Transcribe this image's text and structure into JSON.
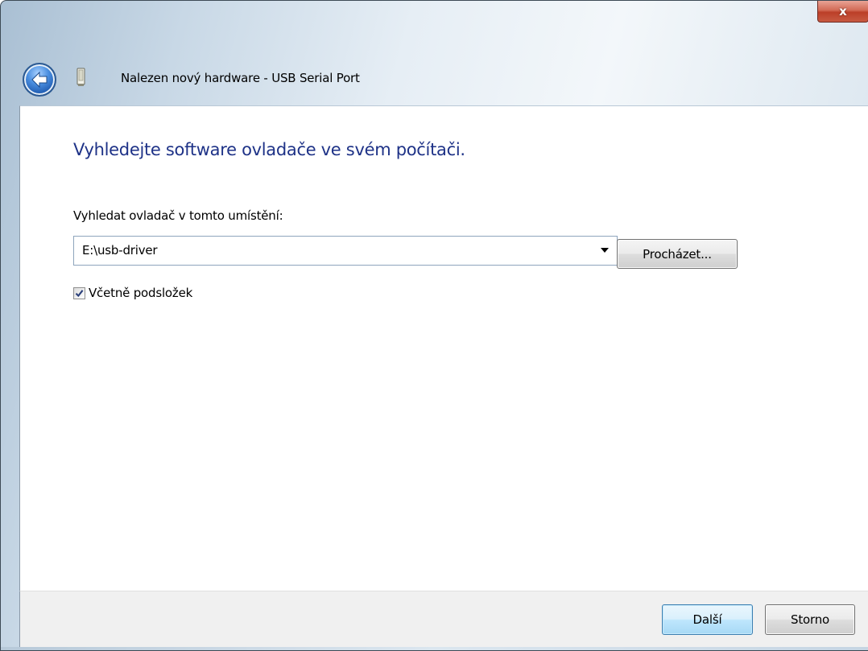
{
  "window": {
    "title": "Nalezen nový hardware - USB Serial Port",
    "close_glyph": "x",
    "icons": {
      "back": "back-arrow-icon",
      "hardware": "usb-device-icon",
      "close": "close-icon"
    }
  },
  "main": {
    "heading": "Vyhledejte software ovladače ve svém počítači.",
    "location_label": "Vyhledat ovladač v tomto umístění:",
    "path_value": "E:\\usb-driver",
    "browse_label": "Procházet...",
    "subfolders_label": "Včetně podsložek",
    "subfolders_checked": true
  },
  "footer": {
    "next_label": "Další",
    "cancel_label": "Storno"
  },
  "colors": {
    "heading": "#1e3287",
    "close_button": "#c85a42",
    "next_button_border": "#3c7fb1"
  }
}
